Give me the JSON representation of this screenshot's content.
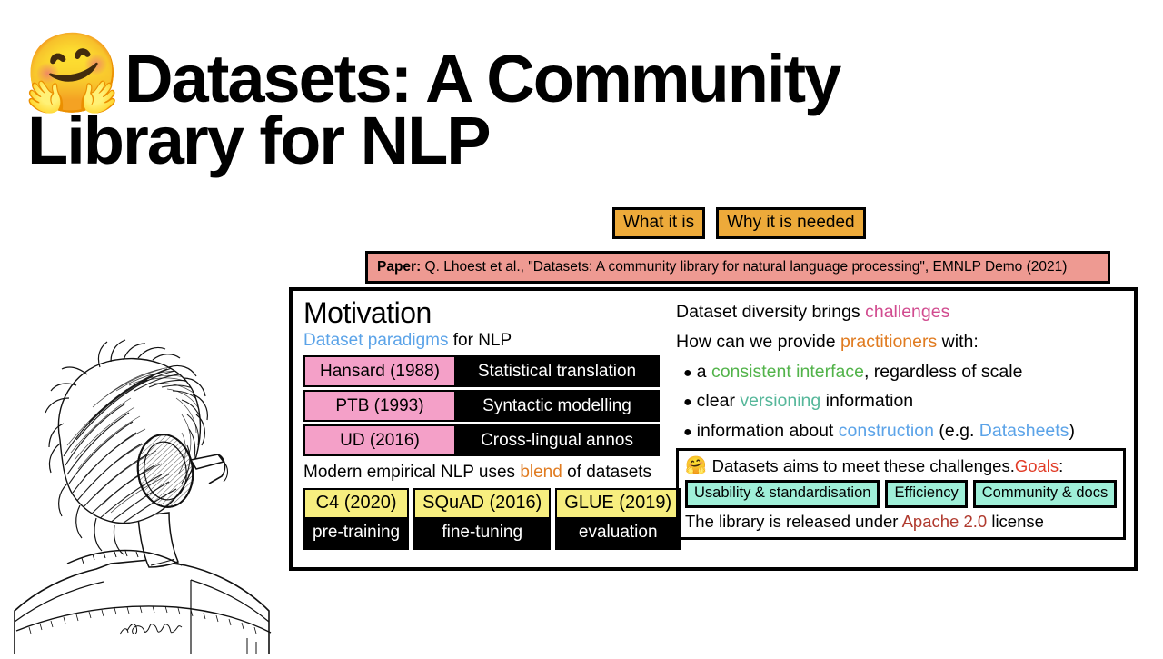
{
  "title": {
    "emoji": "🤗",
    "line1": "Datasets: A Community",
    "line2": "Library for NLP"
  },
  "chips": [
    {
      "label": "What it is"
    },
    {
      "label": "Why it is needed"
    }
  ],
  "paper": {
    "label": "Paper:",
    "citation": " Q. Lhoest et al., \"Datasets: A community library for natural language processing\", EMNLP Demo (2021)"
  },
  "motivation": {
    "heading": "Motivation",
    "subline_colored": "Dataset paradigms",
    "subline_rest": " for NLP",
    "paradigms": [
      {
        "dataset": "Hansard (1988)",
        "use": "Statistical translation"
      },
      {
        "dataset": "PTB (1993)",
        "use": "Syntactic modelling"
      },
      {
        "dataset": "UD (2016)",
        "use": "Cross-lingual annos"
      }
    ],
    "blend_pre": "Modern empirical NLP uses ",
    "blend_word": "blend",
    "blend_post": " of datasets",
    "stages": [
      {
        "dataset": "C4 (2020)",
        "stage": "pre-training"
      },
      {
        "dataset": "SQuAD (2016)",
        "stage": "fine-tuning"
      },
      {
        "dataset": "GLUE (2019)",
        "stage": "evaluation"
      }
    ]
  },
  "challenges": {
    "line1_pre": "Dataset diversity brings ",
    "line1_word": "challenges",
    "line2_pre": "How can we provide ",
    "line2_word": "practitioners",
    "line2_post": " with:",
    "bullets": [
      {
        "pre": "a ",
        "word": "consistent interface",
        "post": ", regardless of scale"
      },
      {
        "pre": "clear ",
        "word": "versioning",
        "post": " information"
      },
      {
        "pre": "information about ",
        "word": "construction",
        "post": " (e.g. ",
        "word2": "Datasheets",
        "post2": ")"
      }
    ]
  },
  "goals": {
    "emoji": "🤗",
    "head_pre": "Datasets aims to meet these challenges. ",
    "head_word": "Goals",
    "head_post": ":",
    "chips": [
      {
        "label": "Usability & standardisation"
      },
      {
        "label": "Efficiency"
      },
      {
        "label": "Community & docs"
      }
    ],
    "footer_pre": "The library is released under ",
    "footer_word": "Apache 2.0",
    "footer_post": " license"
  },
  "illustration": {
    "description": "pen-and-ink sketch of a person seen from behind wearing headphones",
    "signature": "JoanaSilva"
  },
  "colors": {
    "chip_orange": "#EDAA3A",
    "paper_salmon": "#EE9A92",
    "pink": "#F4A0C8",
    "yellow": "#F7EE7F",
    "teal": "#9FEFD8",
    "blue": "#5BA3E8",
    "orange_text": "#E07B20",
    "magenta": "#D14B8F",
    "green": "#52B34A",
    "teal_text": "#56B79A",
    "red": "#E13B26",
    "dark_red": "#B03A2E"
  }
}
